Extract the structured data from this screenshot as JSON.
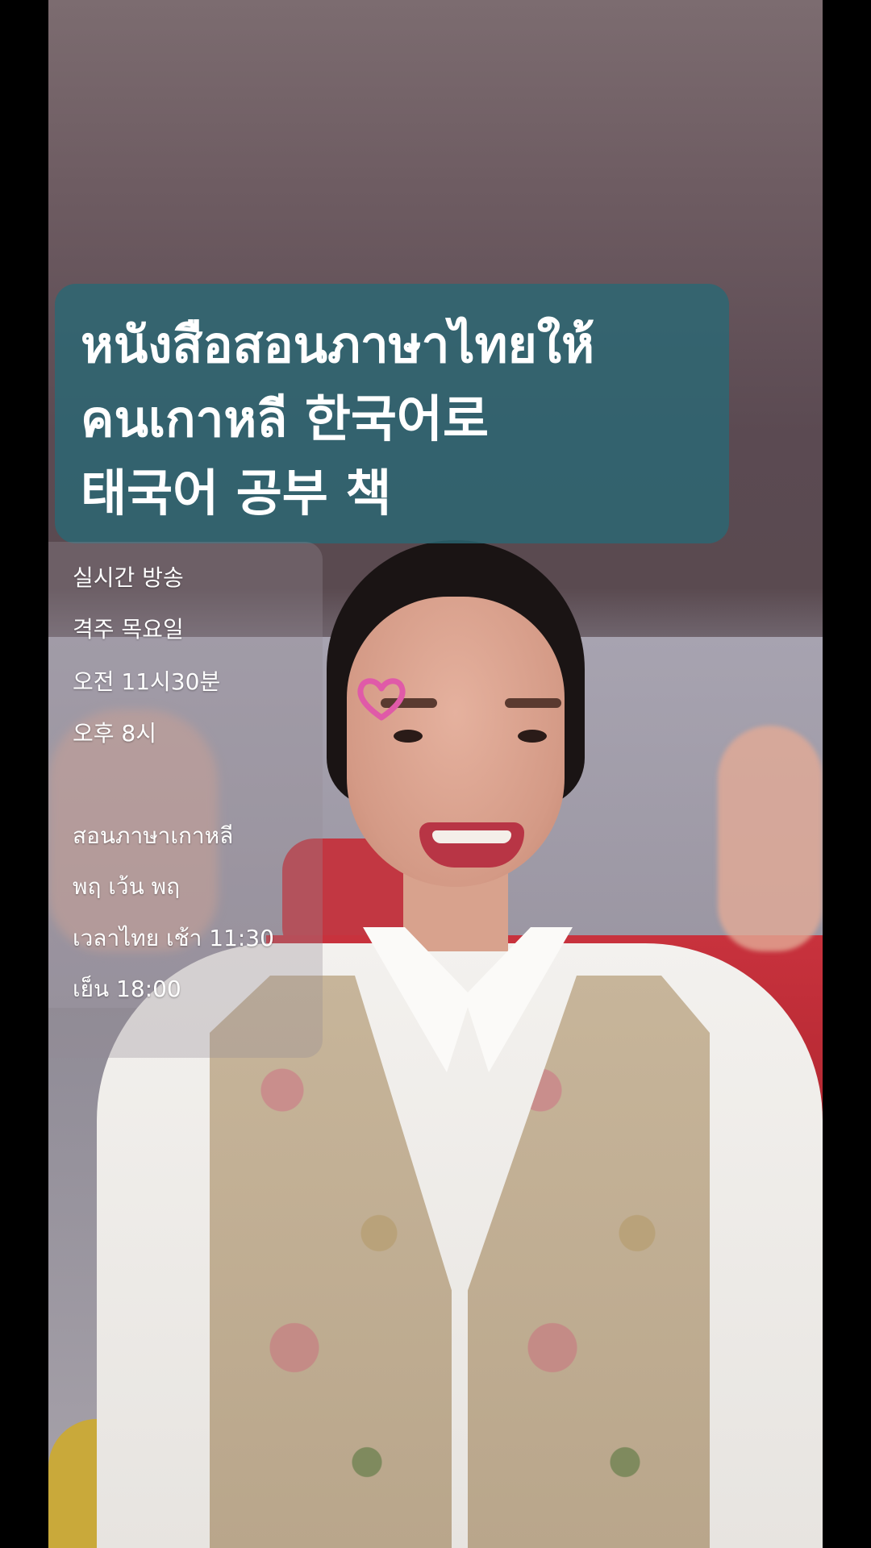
{
  "title": {
    "lines": [
      "หนังสือสอนภาษาไทยให้",
      "คนเกาหลี 한국어로",
      "태국어 공부 책"
    ]
  },
  "schedule": {
    "korean": [
      "실시간 방송",
      "격주 목요일",
      "오전 11시30분",
      "오후 8시"
    ],
    "thai": [
      "สอนภาษาเกาหลี",
      "พฤ เว้น พฤ",
      "เวลาไทย เช้า 11:30",
      "เย็น 18:00"
    ]
  },
  "colors": {
    "title_box": "#2b6874",
    "heart": "#e05aa8",
    "headboard": "#c8323d"
  },
  "icons": {
    "heart": "heart-sticker-icon"
  }
}
